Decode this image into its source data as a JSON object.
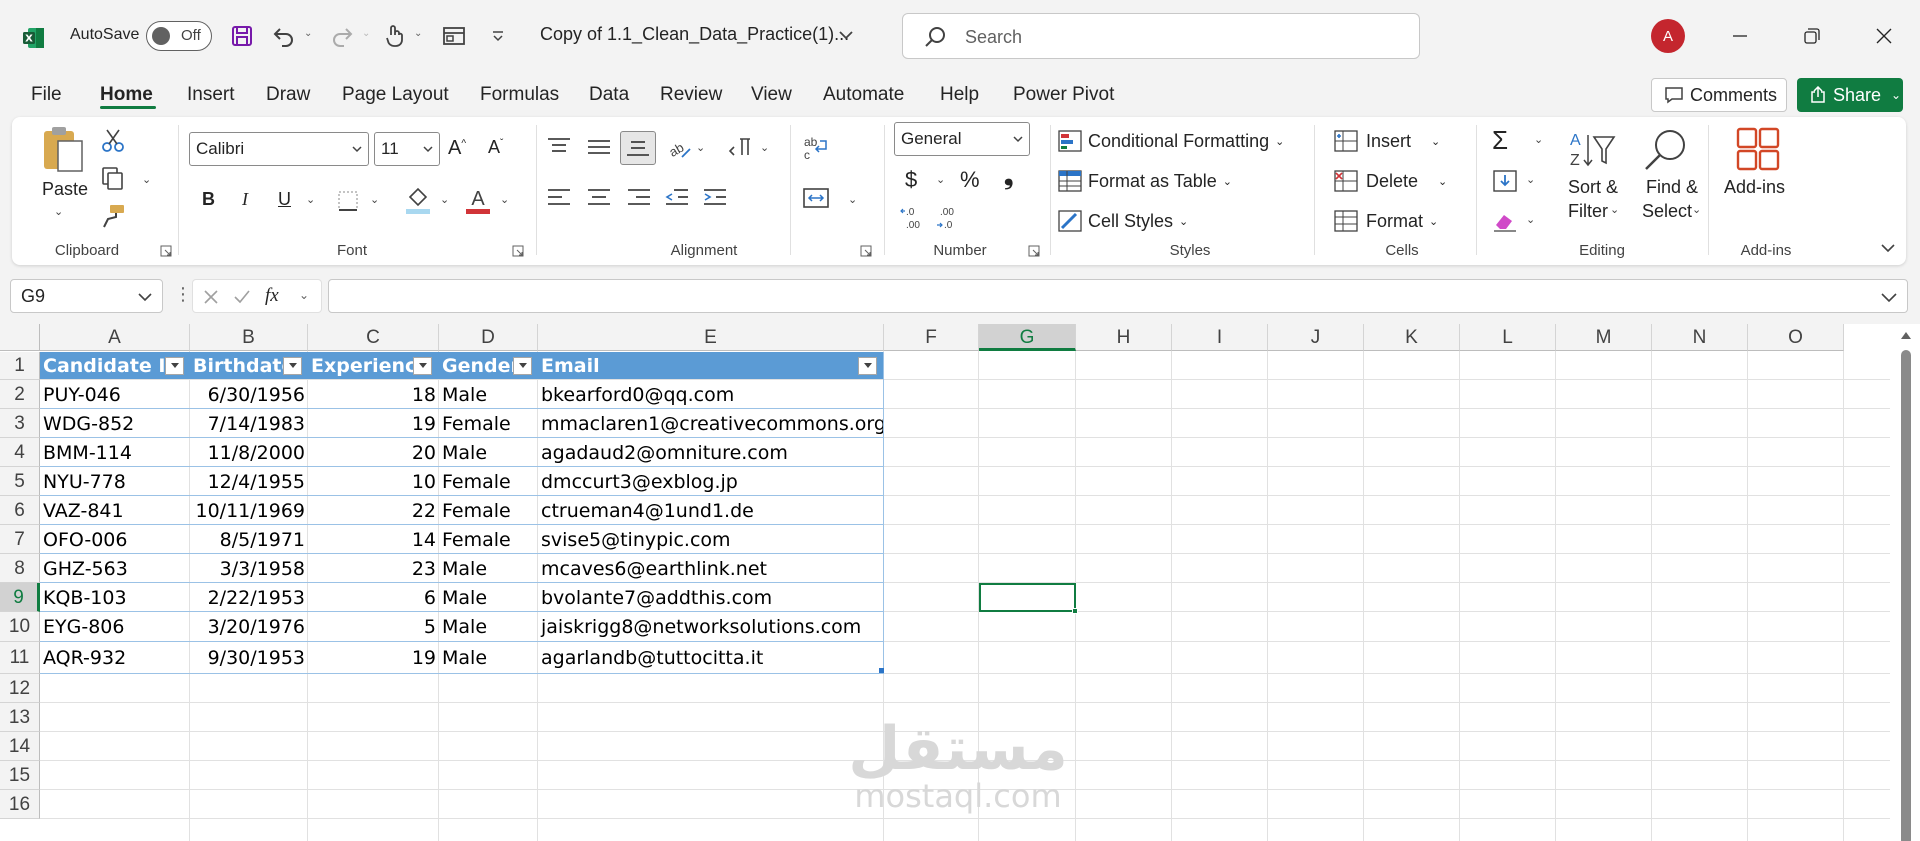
{
  "titlebar": {
    "autosave_label": "AutoSave",
    "autosave_state": "Off",
    "document_title": "Copy of 1.1_Clean_Data_Practice(1)...",
    "search_placeholder": "Search",
    "avatar_initial": "A"
  },
  "menu": {
    "tabs": [
      "File",
      "Home",
      "Insert",
      "Draw",
      "Page Layout",
      "Formulas",
      "Data",
      "Review",
      "View",
      "Automate",
      "Help",
      "Power Pivot"
    ],
    "active_tab": "Home",
    "comments_label": "Comments",
    "share_label": "Share"
  },
  "ribbon": {
    "clipboard": {
      "paste_label": "Paste",
      "group_label": "Clipboard"
    },
    "font": {
      "font_name": "Calibri",
      "font_size": "11",
      "group_label": "Font",
      "bold": "B",
      "italic": "I",
      "underline": "U"
    },
    "alignment": {
      "group_label": "Alignment"
    },
    "number": {
      "format": "General",
      "group_label": "Number",
      "currency": "$",
      "percent": "%",
      "comma": "❟",
      "inc_decimal": "←.0 .00",
      "dec_decimal": ".00 →.0"
    },
    "styles": {
      "conditional_formatting": "Conditional Formatting",
      "format_as_table": "Format as Table",
      "cell_styles": "Cell Styles",
      "group_label": "Styles"
    },
    "cells": {
      "insert": "Insert",
      "delete": "Delete",
      "format": "Format",
      "group_label": "Cells"
    },
    "editing": {
      "sort_filter_line1": "Sort &",
      "sort_filter_line2": "Filter",
      "find_select_line1": "Find &",
      "find_select_line2": "Select",
      "group_label": "Editing"
    },
    "addins": {
      "label": "Add-ins",
      "group_label": "Add-ins"
    }
  },
  "formula_bar": {
    "name_box": "G9",
    "fx": "fx",
    "formula": ""
  },
  "grid": {
    "columns": [
      "A",
      "B",
      "C",
      "D",
      "E",
      "F",
      "G",
      "H",
      "I",
      "J",
      "K",
      "L",
      "M",
      "N",
      "O"
    ],
    "selected_column": "G",
    "selected_row": "9",
    "rows": [
      "1",
      "2",
      "3",
      "4",
      "5",
      "6",
      "7",
      "8",
      "9",
      "10",
      "11",
      "12",
      "13",
      "14",
      "15",
      "16"
    ],
    "table_headers": [
      "Candidate ID",
      "Birthdate",
      "Experience",
      "Gender",
      "Email"
    ],
    "table_rows": [
      [
        "PUY-046",
        "6/30/1956",
        "18",
        "Male",
        "bkearford0@qq.com"
      ],
      [
        "WDG-852",
        "7/14/1983",
        "19",
        "Female",
        "mmaclaren1@creativecommons.org"
      ],
      [
        "BMM-114",
        "11/8/2000",
        "20",
        "Male",
        "agadaud2@omniture.com"
      ],
      [
        "NYU-778",
        "12/4/1955",
        "10",
        "Female",
        "dmccurt3@exblog.jp"
      ],
      [
        "VAZ-841",
        "10/11/1969",
        "22",
        "Female",
        "ctrueman4@1und1.de"
      ],
      [
        "OFO-006",
        "8/5/1971",
        "14",
        "Female",
        "svise5@tinypic.com"
      ],
      [
        "GHZ-563",
        "3/3/1958",
        "23",
        "Male",
        "mcaves6@earthlink.net"
      ],
      [
        "KQB-103",
        "2/22/1953",
        "6",
        "Male",
        "bvolante7@addthis.com"
      ],
      [
        "EYG-806",
        "3/20/1976",
        "5",
        "Male",
        "jaiskrigg8@networksolutions.com"
      ],
      [
        "AQR-932",
        "9/30/1953",
        "19",
        "Male",
        "agarlandb@tuttocitta.it"
      ]
    ]
  },
  "watermark": {
    "arabic": "مستقل",
    "latin": "mostaql.com"
  },
  "colors": {
    "accent": "#107c41",
    "table_header": "#5b9bd5",
    "table_border": "#9bc2e6",
    "avatar": "#c4262e"
  }
}
